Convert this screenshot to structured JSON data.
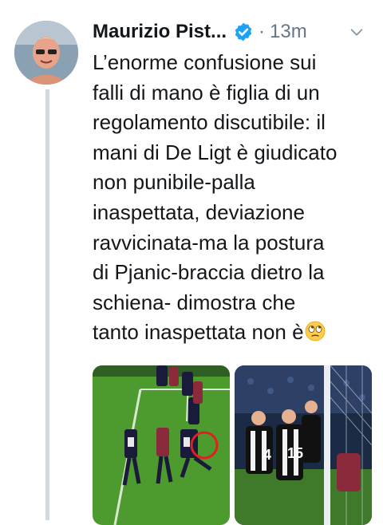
{
  "tweet": {
    "author_name": "Maurizio Pist...",
    "separator": "·",
    "time": "13m",
    "text_lines": [
      "L’enorme confusione sui",
      "falli di mano è figlia di un",
      "regolamento discutibile: il",
      "mani di De Ligt è giudicato",
      "non punibile-palla",
      "inaspettata, deviazione",
      "ravvicinata-ma la postura",
      "di Pjanic-braccia dietro la",
      "schiena- dimostra che",
      "tanto inaspettata non è"
    ],
    "icons": {
      "verified": "verified-badge-icon",
      "menu": "chevron-down-icon",
      "emoji": "eye-roll-emoji"
    },
    "accent_color": "#1da1f2"
  }
}
